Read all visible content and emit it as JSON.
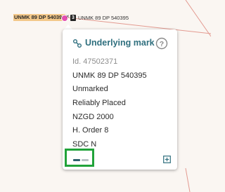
{
  "map": {
    "selected_label": "UNMK 89 DP 540395",
    "neighbor_label": "UNMK 89 DP 540395",
    "mark_cross": "×",
    "badge_count": "3"
  },
  "panel": {
    "header_icon": "mark-nodes-icon",
    "title": "Underlying mark",
    "help_icon": "question-circle-icon",
    "rows": [
      "Id. 47502371",
      "UNMK 89 DP 540395",
      "Unmarked",
      "Reliably Placed",
      "NZGD 2000",
      "H. Order 8",
      "SDC N"
    ],
    "footer": {
      "pager_icon": "page-dots-icon",
      "expand_icon": "expand-plus-icon"
    }
  },
  "colors": {
    "accent": "#2f6f7e",
    "highlight": "#21a33a",
    "mark": "#e34fb0",
    "label_bg": "#f3c88a",
    "map_line": "#e39a90"
  }
}
